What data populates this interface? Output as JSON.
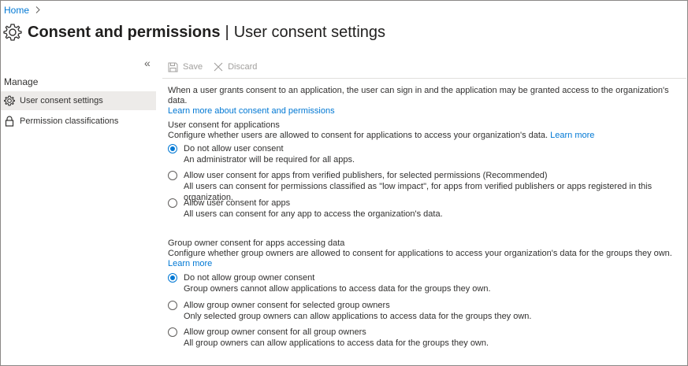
{
  "breadcrumb": {
    "home": "Home",
    "chevron": "›"
  },
  "title": {
    "main": "Consent and permissions",
    "separator": "|",
    "sub": "User consent settings"
  },
  "sidebar": {
    "collapse_glyph": "«",
    "section": "Manage",
    "items": [
      {
        "label": "User consent settings",
        "icon": "gear-icon",
        "selected": true
      },
      {
        "label": "Permission classifications",
        "icon": "lock-icon",
        "selected": false
      }
    ]
  },
  "toolbar": {
    "save": "Save",
    "discard": "Discard"
  },
  "intro": {
    "text": "When a user grants consent to an application, the user can sign in and the application may be granted access to the organization's data.",
    "link": "Learn more about consent and permissions"
  },
  "user_consent": {
    "title": "User consent for applications",
    "description": "Configure whether users are allowed to consent for applications to access your organization's data.",
    "link": "Learn more",
    "options": [
      {
        "label": "Do not allow user consent",
        "sub": "An administrator will be required for all apps.",
        "checked": true
      },
      {
        "label": "Allow user consent for apps from verified publishers, for selected permissions (Recommended)",
        "sub": "All users can consent for permissions classified as \"low impact\", for apps from verified publishers or apps registered in this organization.",
        "checked": false
      },
      {
        "label": "Allow user consent for apps",
        "sub": "All users can consent for any app to access the organization's data.",
        "checked": false
      }
    ]
  },
  "group_consent": {
    "title": "Group owner consent for apps accessing data",
    "description": "Configure whether group owners are allowed to consent for applications to access your organization's data for the groups they own.",
    "link": "Learn more",
    "options": [
      {
        "label": "Do not allow group owner consent",
        "sub": "Group owners cannot allow applications to access data for the groups they own.",
        "checked": true
      },
      {
        "label": "Allow group owner consent for selected group owners",
        "sub": "Only selected group owners can allow applications to access data for the groups they own.",
        "checked": false
      },
      {
        "label": "Allow group owner consent for all group owners",
        "sub": "All group owners can allow applications to access data for the groups they own.",
        "checked": false
      }
    ]
  },
  "colors": {
    "accent": "#0078d4",
    "selected_bg": "#edebe9",
    "disabled_text": "#a19f9d"
  }
}
